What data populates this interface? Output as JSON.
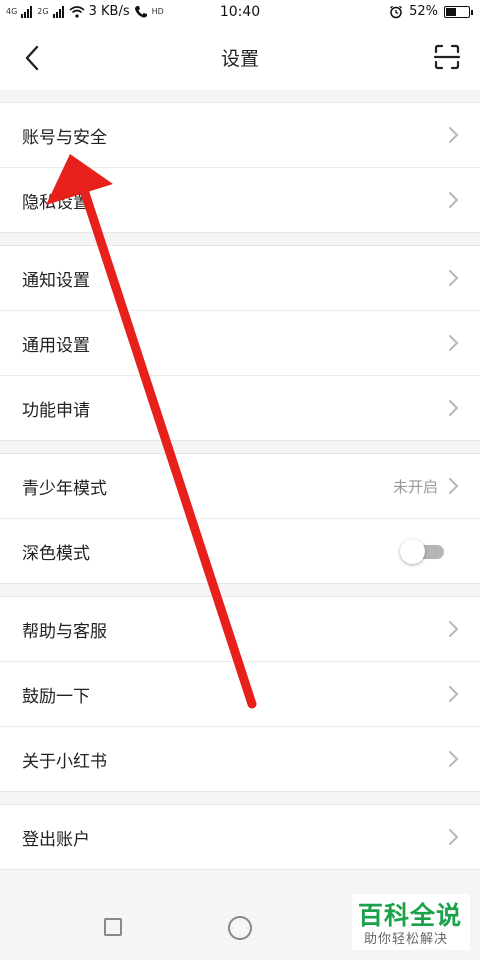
{
  "status_bar": {
    "signal_1": "4G",
    "signal_2": "2G",
    "speed": "3 KB/s",
    "hd": "HD",
    "time": "10:40",
    "battery_pct": "52%",
    "battery_level": 52
  },
  "header": {
    "title": "设置",
    "back_icon": "chevron-left-icon",
    "scan_icon": "scan-icon"
  },
  "groups": [
    {
      "items": [
        {
          "label": "账号与安全"
        },
        {
          "label": "隐私设置"
        }
      ]
    },
    {
      "items": [
        {
          "label": "通知设置"
        },
        {
          "label": "通用设置"
        },
        {
          "label": "功能申请"
        }
      ]
    },
    {
      "items": [
        {
          "label": "青少年模式",
          "value": "未开启"
        },
        {
          "label": "深色模式",
          "toggle_on": false
        }
      ]
    },
    {
      "items": [
        {
          "label": "帮助与客服"
        },
        {
          "label": "鼓励一下"
        },
        {
          "label": "关于小红书"
        }
      ]
    },
    {
      "items": [
        {
          "label": "登出账户"
        }
      ]
    }
  ],
  "watermark": {
    "main": "百科全说",
    "sub": "助你轻松解决"
  },
  "colors": {
    "arrow": "#e8201c",
    "watermark": "#1aa24a",
    "toggle_off": "#b5b5b5"
  }
}
